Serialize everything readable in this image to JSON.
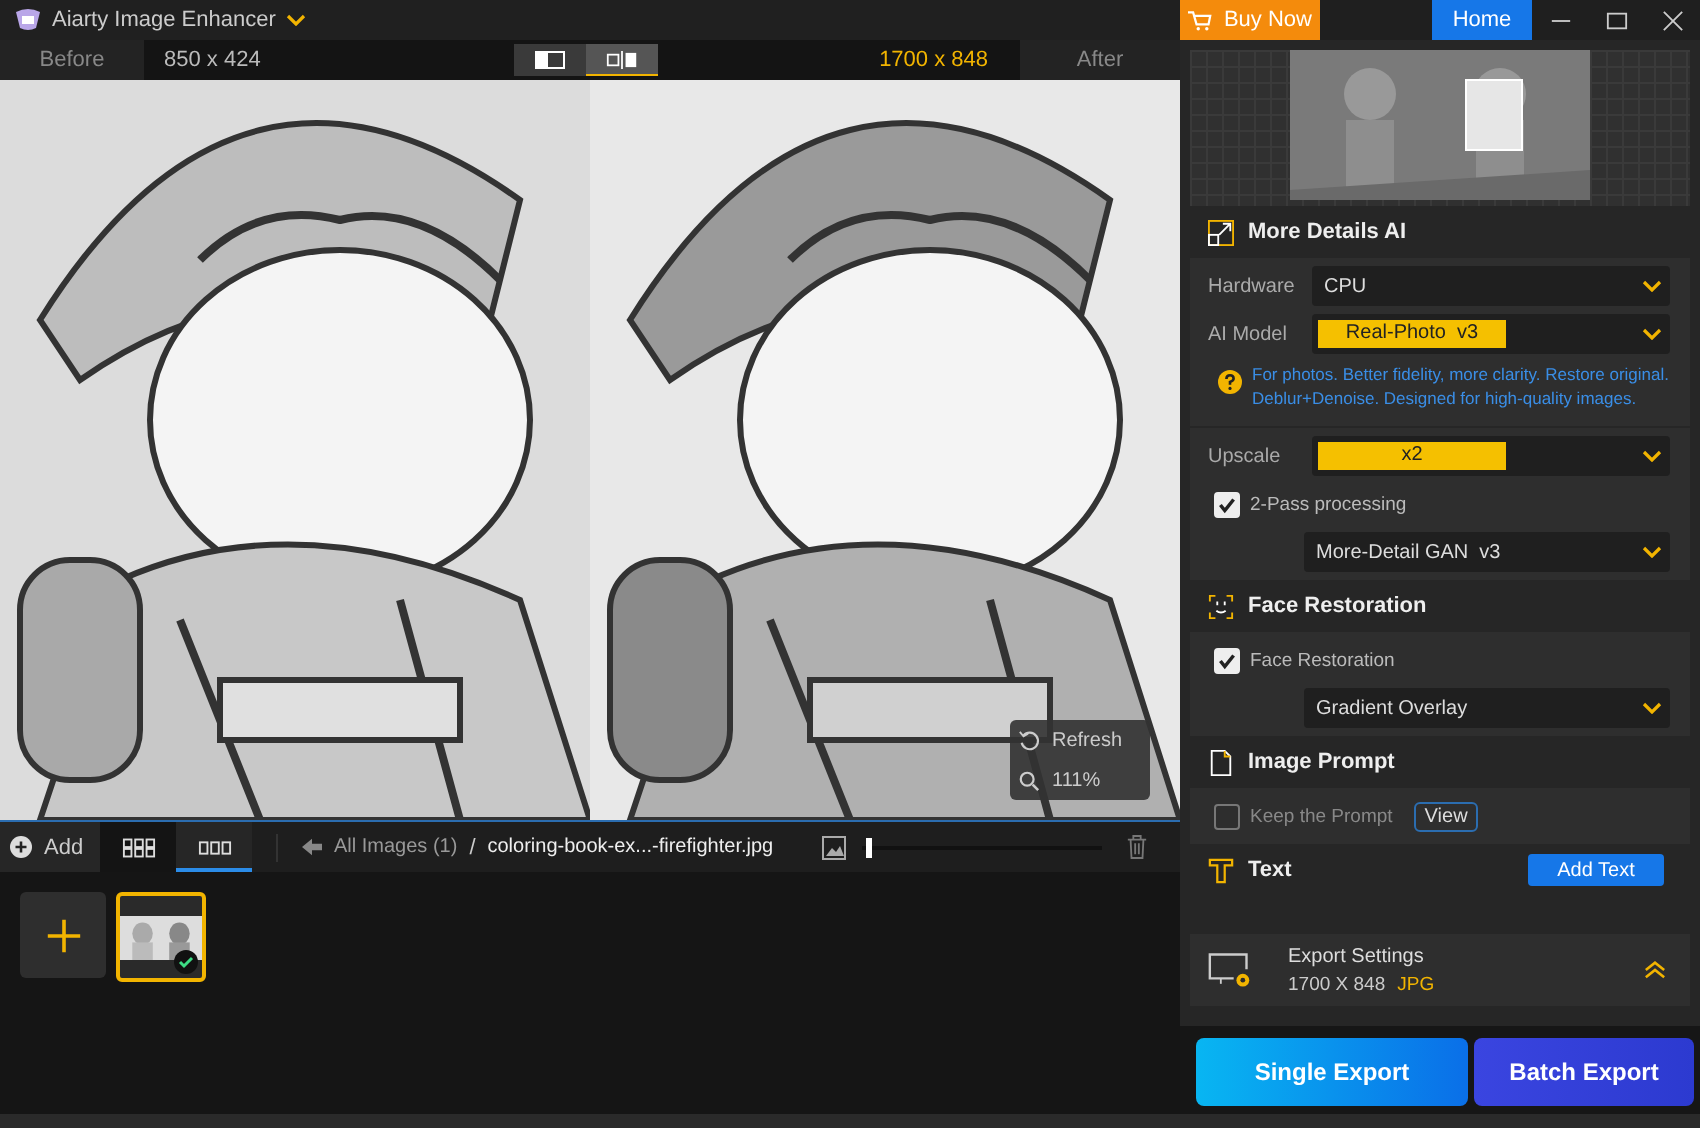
{
  "title_bar": {
    "app_name": "Aiarty Image Enhancer",
    "buy_label": "Buy Now",
    "home_label": "Home"
  },
  "compare_bar": {
    "before_label": "Before",
    "before_size": "850 x 424",
    "after_size": "1700 x 848",
    "after_label": "After",
    "view_modes": [
      {
        "kind": "single",
        "selected": false
      },
      {
        "kind": "split",
        "selected": true
      }
    ]
  },
  "viewer": {
    "refresh_label": "Refresh",
    "zoom": "111%"
  },
  "toolbar": {
    "add_label": "Add",
    "layouts": [
      {
        "kind": "grid",
        "selected": false
      },
      {
        "kind": "strip",
        "selected": true
      }
    ],
    "breadcrumb": "All Images (1)",
    "separator": "/",
    "file_name": "coloring-book-ex...-firefighter.jpg",
    "slider": {
      "level": 0.02
    }
  },
  "gallery": {
    "items": [
      {
        "kind": "add"
      },
      {
        "kind": "picture",
        "selected": true,
        "done": true
      }
    ]
  },
  "panel": {
    "more_details": {
      "title": "More Details AI",
      "hardware": {
        "label": "Hardware",
        "value": "CPU",
        "highlighted": false
      },
      "ai_model": {
        "label": "AI Model",
        "value": "Real-Photo  v3",
        "highlighted": true
      },
      "note": "For photos. Better fidelity, more clarity. Restore original. Deblur+Denoise. Designed for high-quality images.",
      "upscale": {
        "label": "Upscale",
        "value": "x2",
        "highlighted": true
      },
      "two_pass": {
        "label": "2-Pass processing",
        "checked": true,
        "value": "More-Detail GAN  v3"
      }
    },
    "face": {
      "title": "Face Restoration",
      "label": "Face Restoration",
      "checked": true,
      "value": "Gradient Overlay"
    },
    "prompt": {
      "title": "Image Prompt",
      "label": "Keep the Prompt",
      "checked": false,
      "view_label": "View"
    },
    "text": {
      "title": "Text",
      "button": "Add Text"
    },
    "export": {
      "title": "Export Settings",
      "size": "1700 X 848",
      "format": "JPG",
      "single_label": "Single Export",
      "batch_label": "Batch Export"
    }
  }
}
